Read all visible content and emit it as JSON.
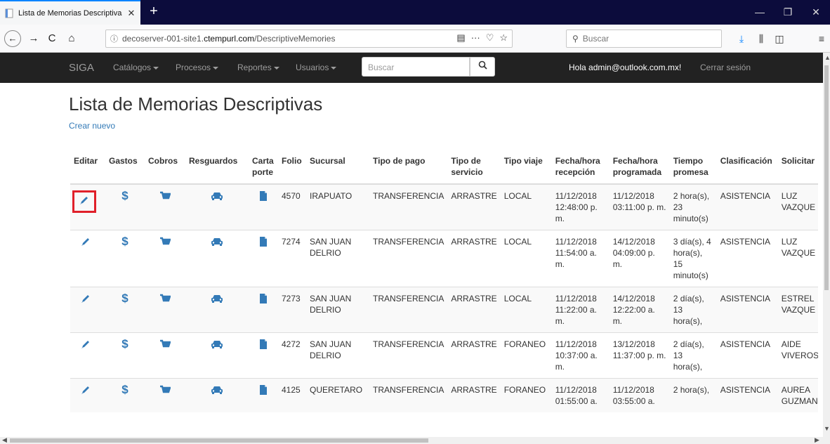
{
  "browser": {
    "tab_title": "Lista de Memorias Descriptivas",
    "tab_close": "✕",
    "new_tab": "+",
    "url_host": "decoserver-001-site1.",
    "url_domain": "ctempurl.com",
    "url_path": "/DescriptiveMemories",
    "search_placeholder": "Buscar"
  },
  "app": {
    "brand": "SIGA",
    "menus": [
      "Catálogos",
      "Procesos",
      "Reportes",
      "Usuarios"
    ],
    "search_placeholder": "Buscar",
    "greeting": "Hola admin@outlook.com.mx!",
    "logout": "Cerrar sesión"
  },
  "page": {
    "title": "Lista de Memorias Descriptivas",
    "create_link": "Crear nuevo"
  },
  "table": {
    "headers": {
      "editar": "Editar",
      "gastos": "Gastos",
      "cobros": "Cobros",
      "resguardos": "Resguardos",
      "carta": "Carta porte",
      "folio": "Folio",
      "sucursal": "Sucursal",
      "tipo_pago": "Tipo de pago",
      "tipo_servicio": "Tipo de servicio",
      "tipo_viaje": "Tipo viaje",
      "fecha_recepcion": "Fecha/hora recepción",
      "fecha_programada": "Fecha/hora programada",
      "tiempo": "Tiempo promesa",
      "clasificacion": "Clasificación",
      "solicitante": "Solicitar"
    },
    "icons": {
      "edit": "pencil-icon",
      "gastos": "dollar-icon",
      "cobros": "cart-icon",
      "resguardos": "car-icon",
      "carta": "file-icon"
    },
    "rows": [
      {
        "folio": "4570",
        "sucursal": "IRAPUATO",
        "tipo_pago": "TRANSFERENCIA",
        "tipo_servicio": "ARRASTRE",
        "tipo_viaje": "LOCAL",
        "fecha_recepcion": "11/12/2018 12:48:00 p. m.",
        "fecha_programada": "11/12/2018 03:11:00 p. m.",
        "tiempo": "2 hora(s), 23 minuto(s)",
        "clasificacion": "ASISTENCIA",
        "solicitante": "LUZ VAZQUE"
      },
      {
        "folio": "7274",
        "sucursal": "SAN JUAN DELRIO",
        "tipo_pago": "TRANSFERENCIA",
        "tipo_servicio": "ARRASTRE",
        "tipo_viaje": "LOCAL",
        "fecha_recepcion": "11/12/2018 11:54:00 a. m.",
        "fecha_programada": "14/12/2018 04:09:00 p. m.",
        "tiempo": "3 día(s), 4 hora(s), 15 minuto(s)",
        "clasificacion": "ASISTENCIA",
        "solicitante": "LUZ VAZQUE"
      },
      {
        "folio": "7273",
        "sucursal": "SAN JUAN DELRIO",
        "tipo_pago": "TRANSFERENCIA",
        "tipo_servicio": "ARRASTRE",
        "tipo_viaje": "LOCAL",
        "fecha_recepcion": "11/12/2018 11:22:00 a. m.",
        "fecha_programada": "14/12/2018 12:22:00 a. m.",
        "tiempo": "2 día(s), 13 hora(s),",
        "clasificacion": "ASISTENCIA",
        "solicitante": "ESTREL VAZQUE"
      },
      {
        "folio": "4272",
        "sucursal": "SAN JUAN DELRIO",
        "tipo_pago": "TRANSFERENCIA",
        "tipo_servicio": "ARRASTRE",
        "tipo_viaje": "FORANEO",
        "fecha_recepcion": "11/12/2018 10:37:00 a. m.",
        "fecha_programada": "13/12/2018 11:37:00 p. m.",
        "tiempo": "2 día(s), 13 hora(s),",
        "clasificacion": "ASISTENCIA",
        "solicitante": "AIDE VIVEROS"
      },
      {
        "folio": "4125",
        "sucursal": "QUERETARO",
        "tipo_pago": "TRANSFERENCIA",
        "tipo_servicio": "ARRASTRE",
        "tipo_viaje": "FORANEO",
        "fecha_recepcion": "11/12/2018 01:55:00 a.",
        "fecha_programada": "11/12/2018 03:55:00 a.",
        "tiempo": "2 hora(s),",
        "clasificacion": "ASISTENCIA",
        "solicitante": "AUREA GUZMAN"
      }
    ]
  },
  "colors": {
    "accent_blue": "#337ab7",
    "focus_red": "#e0202a",
    "appbar": "#222222",
    "tabstrip": "#0c0c3c"
  }
}
